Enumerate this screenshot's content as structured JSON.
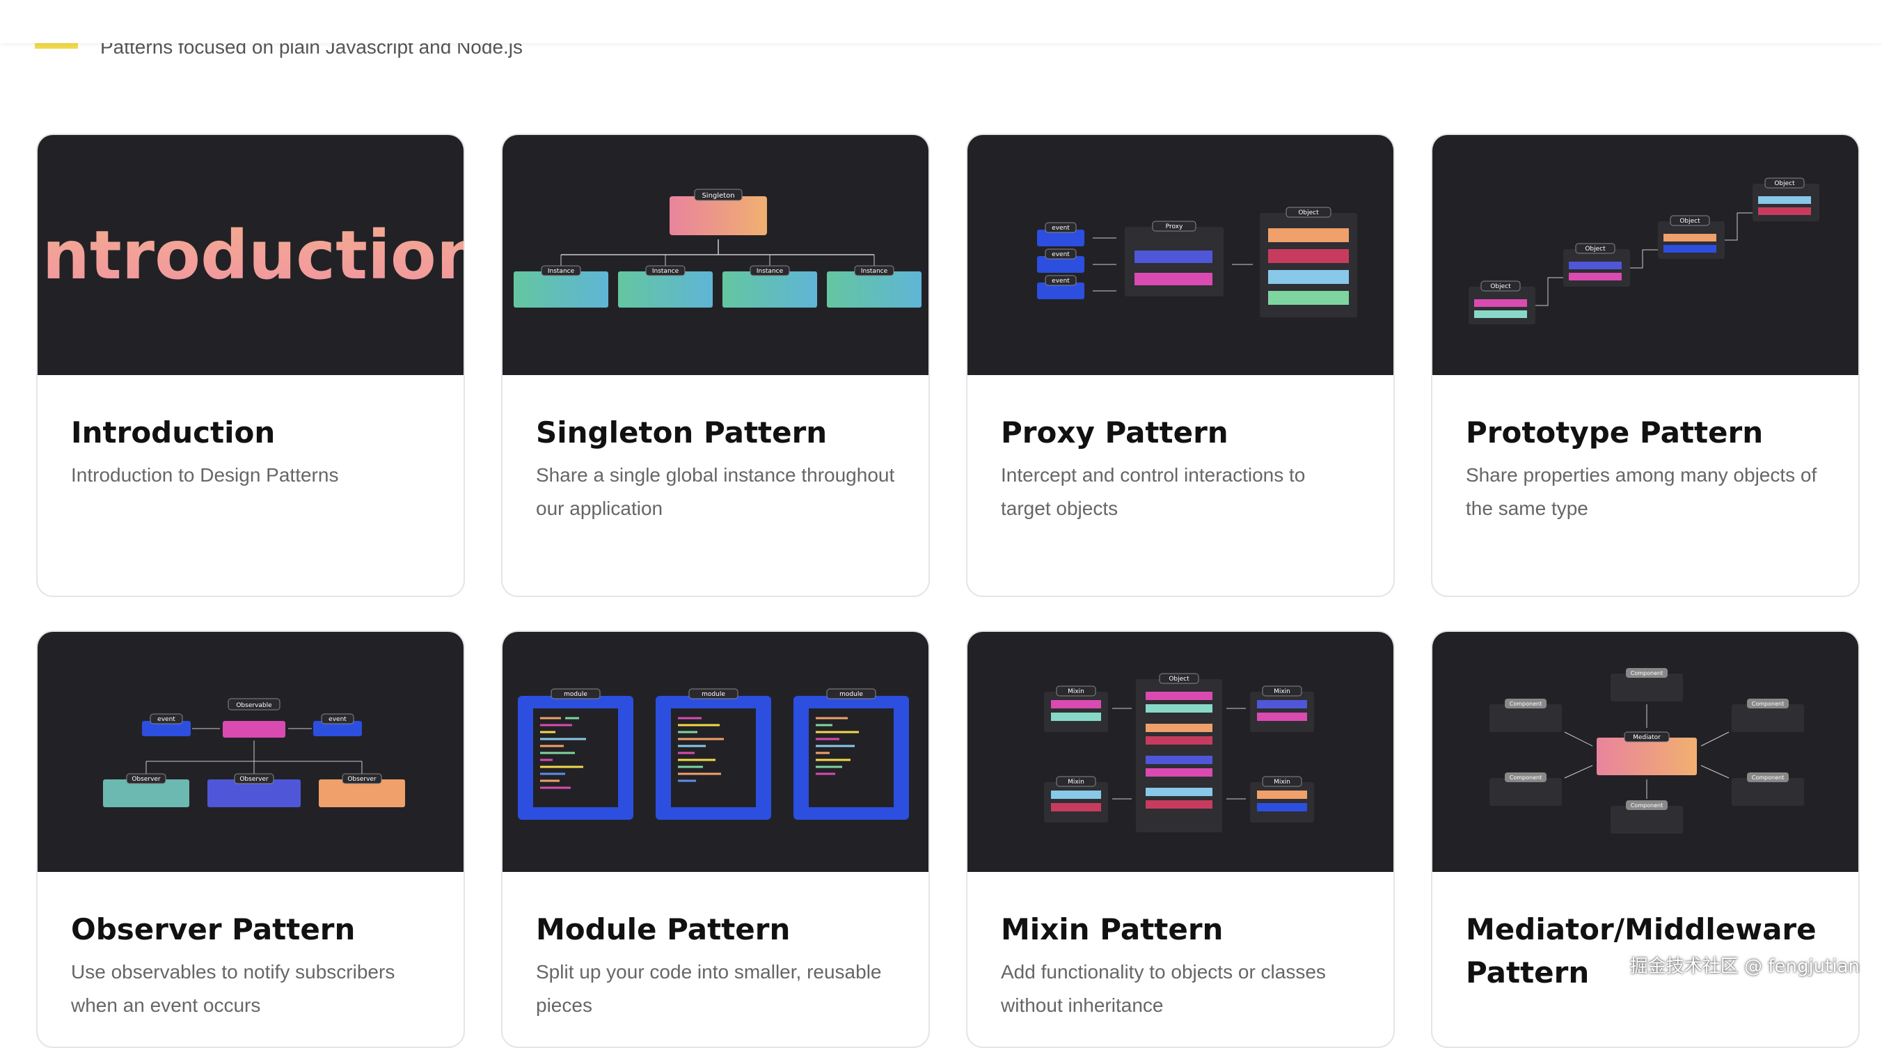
{
  "header": {
    "subtitle": "Patterns focused on plain Javascript and Node.js",
    "logo_icon": "js-logo-icon",
    "logo_color": "#f2d94a"
  },
  "cards": [
    {
      "title": "Introduction",
      "description": "Introduction to Design Patterns",
      "thumb_text": "Introduction"
    },
    {
      "title": "Singleton Pattern",
      "description": "Share a single global instance throughout our application",
      "diagram": {
        "top": "Singleton",
        "children": [
          "Instance",
          "Instance",
          "Instance",
          "Instance"
        ]
      }
    },
    {
      "title": "Proxy Pattern",
      "description": "Intercept and control interactions to target objects",
      "diagram": {
        "events": [
          "event",
          "event",
          "event"
        ],
        "middle": "Proxy",
        "right": "Object"
      }
    },
    {
      "title": "Prototype Pattern",
      "description": "Share properties among many objects of the same type",
      "diagram": {
        "labels": [
          "Object",
          "Object",
          "Object",
          "Object"
        ]
      }
    },
    {
      "title": "Observer Pattern",
      "description": "Use observables to notify subscribers when an event occurs",
      "diagram": {
        "top": "Observable",
        "events": [
          "event",
          "event"
        ],
        "children": [
          "Observer",
          "Observer",
          "Observer"
        ]
      }
    },
    {
      "title": "Module Pattern",
      "description": "Split up your code into smaller, reusable pieces",
      "diagram": {
        "labels": [
          "module",
          "module",
          "module"
        ]
      }
    },
    {
      "title": "Mixin Pattern",
      "description": "Add functionality to objects or classes without inheritance",
      "diagram": {
        "left": [
          "Mixin",
          "Mixin"
        ],
        "middle": "Object",
        "right": [
          "Mixin",
          "Mixin"
        ]
      }
    },
    {
      "title": "Mediator/Middleware Pattern",
      "description": "",
      "diagram": {
        "center": "Mediator",
        "nodes": [
          "Component",
          "Component",
          "Component",
          "Component",
          "Component",
          "Component"
        ]
      }
    }
  ],
  "watermark": "掘金技术社区 @ fengjutian",
  "colors": {
    "thumb_bg": "#222226",
    "card_border": "#e5e5e5",
    "blue": "#2c4fe0"
  }
}
